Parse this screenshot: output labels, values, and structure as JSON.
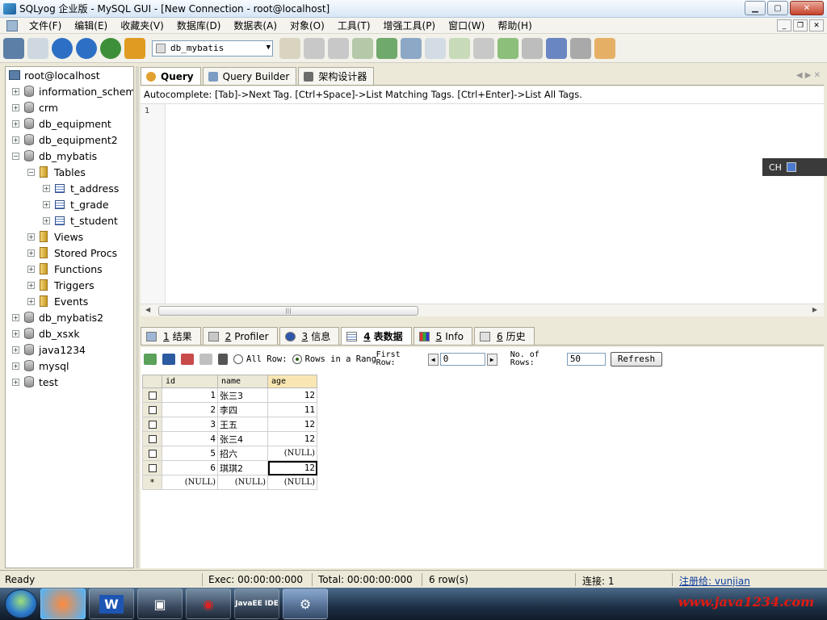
{
  "window": {
    "title": "SQLyog 企业版 - MySQL GUI - [New Connection - root@localhost]",
    "min": "▁",
    "max": "▢",
    "close": "✕"
  },
  "menu": [
    "文件(F)",
    "编辑(E)",
    "收藏夹(V)",
    "数据库(D)",
    "数据表(A)",
    "对象(O)",
    "工具(T)",
    "增强工具(P)",
    "窗口(W)",
    "帮助(H)"
  ],
  "mdi": {
    "min": "_",
    "restore": "❐",
    "close": "✕"
  },
  "toolbar": {
    "db_selector": "db_mybatis",
    "icons": [
      "connect-icon",
      "new-connection-icon",
      "execute-icon",
      "execute-all-icon",
      "refresh-icon",
      "stop-icon",
      "user-icon",
      "backup-icon",
      "restore-icon",
      "import-icon",
      "export-icon",
      "schema-icon",
      "query-builder-icon",
      "sync-icon",
      "copy-db-icon",
      "data-sync-icon",
      "scheduler-icon",
      "migration-icon",
      "notify-icon",
      "report-icon"
    ]
  },
  "tree": {
    "root": "root@localhost",
    "items": [
      {
        "label": "information_schema",
        "level": 1,
        "expander": "+",
        "icon": "db"
      },
      {
        "label": "crm",
        "level": 1,
        "expander": "+",
        "icon": "db"
      },
      {
        "label": "db_equipment",
        "level": 1,
        "expander": "+",
        "icon": "db"
      },
      {
        "label": "db_equipment2",
        "level": 1,
        "expander": "+",
        "icon": "db"
      },
      {
        "label": "db_mybatis",
        "level": 1,
        "expander": "−",
        "icon": "db"
      },
      {
        "label": "Tables",
        "level": 2,
        "expander": "−",
        "icon": "folder"
      },
      {
        "label": "t_address",
        "level": 3,
        "expander": "+",
        "icon": "table"
      },
      {
        "label": "t_grade",
        "level": 3,
        "expander": "+",
        "icon": "table"
      },
      {
        "label": "t_student",
        "level": 3,
        "expander": "+",
        "icon": "table"
      },
      {
        "label": "Views",
        "level": 2,
        "expander": "+",
        "icon": "folder"
      },
      {
        "label": "Stored Procs",
        "level": 2,
        "expander": "+",
        "icon": "folder"
      },
      {
        "label": "Functions",
        "level": 2,
        "expander": "+",
        "icon": "folder"
      },
      {
        "label": "Triggers",
        "level": 2,
        "expander": "+",
        "icon": "folder"
      },
      {
        "label": "Events",
        "level": 2,
        "expander": "+",
        "icon": "folder"
      },
      {
        "label": "db_mybatis2",
        "level": 1,
        "expander": "+",
        "icon": "db"
      },
      {
        "label": "db_xsxk",
        "level": 1,
        "expander": "+",
        "icon": "db"
      },
      {
        "label": "java1234",
        "level": 1,
        "expander": "+",
        "icon": "db"
      },
      {
        "label": "mysql",
        "level": 1,
        "expander": "+",
        "icon": "db"
      },
      {
        "label": "test",
        "level": 1,
        "expander": "+",
        "icon": "db"
      }
    ]
  },
  "query_tabs": [
    {
      "label": "Query",
      "active": true
    },
    {
      "label": "Query Builder",
      "active": false
    },
    {
      "label": "架构设计器",
      "active": false
    }
  ],
  "autocomplete_hint": "Autocomplete: [Tab]->Next Tag. [Ctrl+Space]->List Matching Tags. [Ctrl+Enter]->List All Tags.",
  "editor": {
    "line_number": "1"
  },
  "result_tabs": [
    {
      "num": "1",
      "label": "结果",
      "active": false
    },
    {
      "num": "2",
      "label": "Profiler",
      "active": false
    },
    {
      "num": "3",
      "label": "信息",
      "active": false
    },
    {
      "num": "4",
      "label": "表数据",
      "active": true
    },
    {
      "num": "5",
      "label": "Info",
      "active": false
    },
    {
      "num": "6",
      "label": "历史",
      "active": false
    }
  ],
  "gridbar": {
    "opt_all_rows": "All Row:",
    "opt_range": "Rows in a Range",
    "first_row_label_1": "First",
    "first_row_label_2": "Row:",
    "first_row_value": "0",
    "num_rows_label_1": "No. of",
    "num_rows_label_2": "Rows:",
    "num_rows_value": "50",
    "refresh": "Refresh"
  },
  "grid": {
    "columns": [
      "id",
      "name",
      "age"
    ],
    "rows": [
      [
        "1",
        "张三3",
        "12"
      ],
      [
        "2",
        "李四",
        "11"
      ],
      [
        "3",
        "王五",
        "12"
      ],
      [
        "4",
        "张三4",
        "12"
      ],
      [
        "5",
        "招六",
        "(NULL)"
      ],
      [
        "6",
        "琪琪2",
        "12"
      ]
    ],
    "new_row": [
      "(NULL)",
      "(NULL)",
      "(NULL)"
    ],
    "new_row_marker": "*"
  },
  "status": {
    "ready": "Ready",
    "exec": "Exec: 00:00:00:000",
    "total": "Total: 00:00:00:000",
    "rows": "6 row(s)",
    "conn": "连接: 1",
    "reg": "注册给: vunjian"
  },
  "ime": {
    "text": "CH"
  },
  "taskbar": {
    "watermark": "www.java1234.com",
    "apps": [
      "W",
      "▣",
      "◉",
      "JavaEE IDE",
      "⚙"
    ]
  }
}
